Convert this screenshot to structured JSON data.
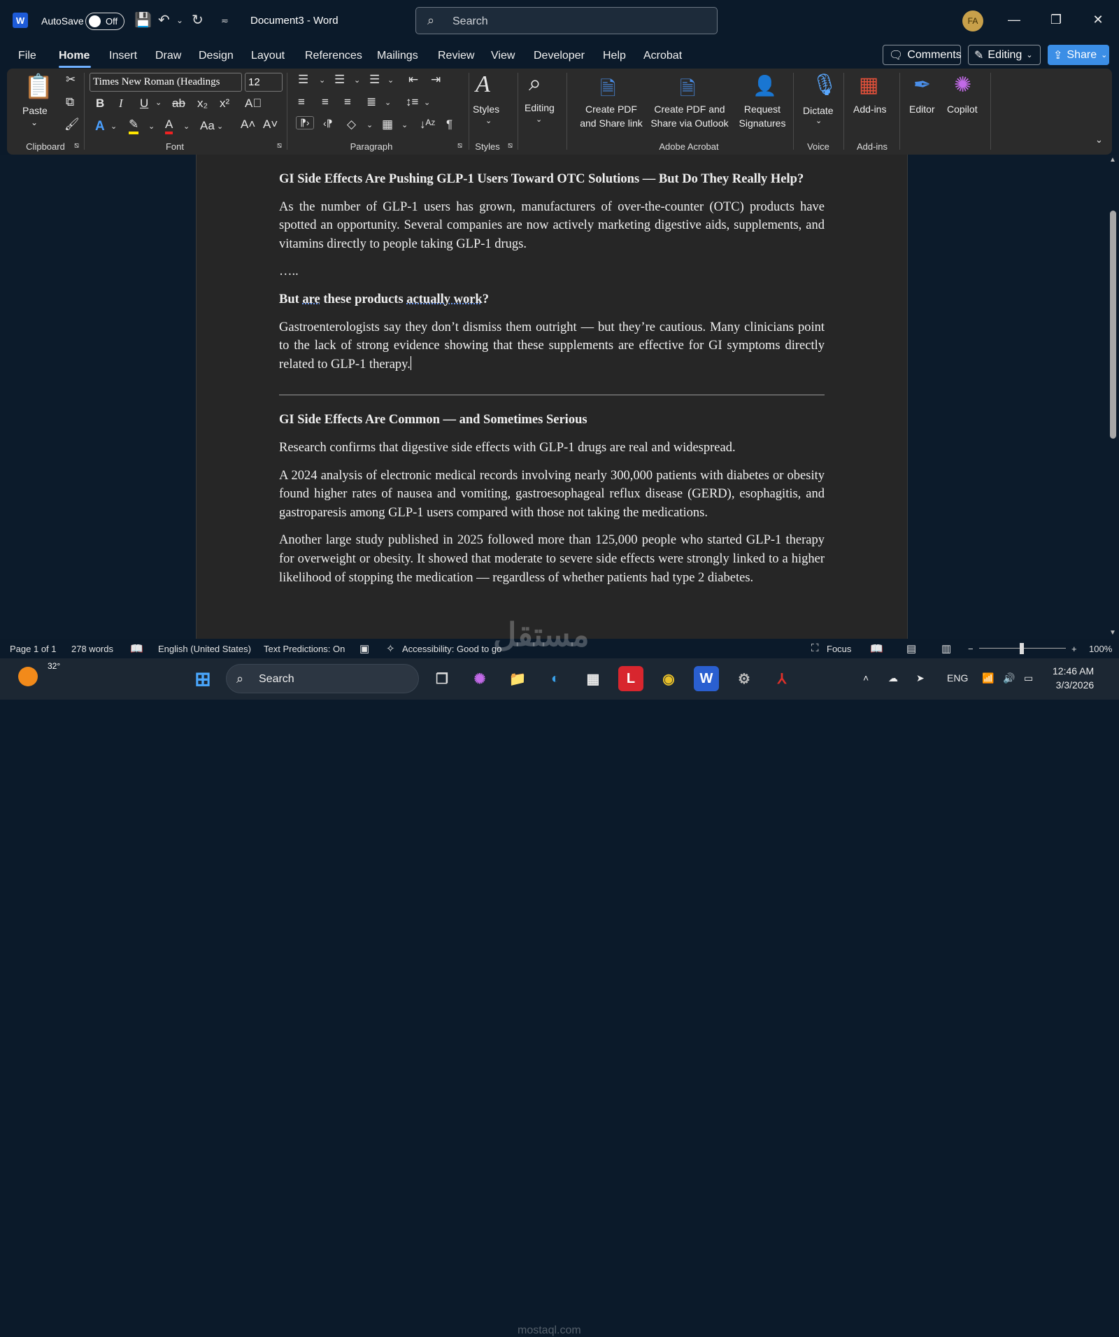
{
  "titlebar": {
    "autosave_label": "AutoSave",
    "toggle_state": "Off",
    "doc_title": "Document3  -  Word",
    "search_placeholder": "Search",
    "avatar_initials": "FA"
  },
  "tabs": [
    "File",
    "Home",
    "Insert",
    "Draw",
    "Design",
    "Layout",
    "References",
    "Mailings",
    "Review",
    "View",
    "Developer",
    "Help",
    "Acrobat"
  ],
  "tab_active": "Home",
  "actions": {
    "comments": "Comments",
    "editing": "Editing",
    "share": "Share"
  },
  "ribbon": {
    "paste": "Paste",
    "font_name": "Times New Roman (Headings",
    "font_size": "12",
    "styles": "Styles",
    "editing": "Editing",
    "create_pdf_share_link": [
      "Create PDF",
      "and Share link"
    ],
    "create_pdf_outlook": [
      "Create PDF and",
      "Share via Outlook"
    ],
    "request_signatures": [
      "Request",
      "Signatures"
    ],
    "dictate": "Dictate",
    "addins": "Add-ins",
    "editor": "Editor",
    "copilot": "Copilot",
    "groups": {
      "clipboard": "Clipboard",
      "font": "Font",
      "paragraph": "Paragraph",
      "styles": "Styles",
      "adobe": "Adobe Acrobat",
      "voice": "Voice",
      "addins": "Add-ins"
    }
  },
  "document": {
    "heading1": "GI Side Effects Are Pushing GLP-1 Users Toward OTC Solutions — But Do They Really Help?",
    "para1": "As the number of GLP-1 users has grown, manufacturers of over-the-counter (OTC) products have spotted an opportunity. Several companies are now actively marketing digestive aids, supplements, and vitamins directly to people taking GLP-1 drugs.",
    "ellipsis": "…..",
    "q_a": "But ",
    "q_b": "are",
    "q_c": " these products ",
    "q_d": "actually work",
    "q_e": "?",
    "para2": "Gastroenterologists say they don’t dismiss them outright — but they’re cautious. Many clinicians point to the lack of strong evidence showing that these supplements are effective for GI symptoms directly related to GLP-1 therapy.",
    "heading2": "GI Side Effects Are Common — and Sometimes Serious",
    "para3": "Research confirms that digestive side effects with GLP-1 drugs are real and widespread.",
    "para4": "A 2024 analysis of electronic medical records involving nearly 300,000 patients with diabetes or obesity found higher rates of nausea and vomiting, gastroesophageal reflux disease (GERD), esophagitis, and gastroparesis among GLP-1 users compared with those not taking the medications.",
    "para5": "Another large study published in 2025 followed more than 125,000 people who started GLP-1 therapy for overweight or obesity. It showed that moderate to severe side effects were strongly linked to a higher likelihood of stopping the medication — regardless of whether patients had type 2 diabetes."
  },
  "status": {
    "page": "Page 1 of 1",
    "words": "278 words",
    "language": "English (United States)",
    "predictions": "Text Predictions: On",
    "accessibility": "Accessibility: Good to go",
    "focus": "Focus",
    "zoom": "100%"
  },
  "taskbar": {
    "search": "Search",
    "weather_temp": "32°",
    "lang": "ENG",
    "time": "12:46 AM",
    "date": "3/3/2026"
  },
  "watermark": {
    "arabic": "مستقل",
    "url": "mostaql.com"
  },
  "colors": {
    "accent": "#3b8ee6",
    "page_bg": "#262626",
    "ribbon_bg": "#2b2b2b",
    "titlebar_bg": "#0b1a2a"
  }
}
